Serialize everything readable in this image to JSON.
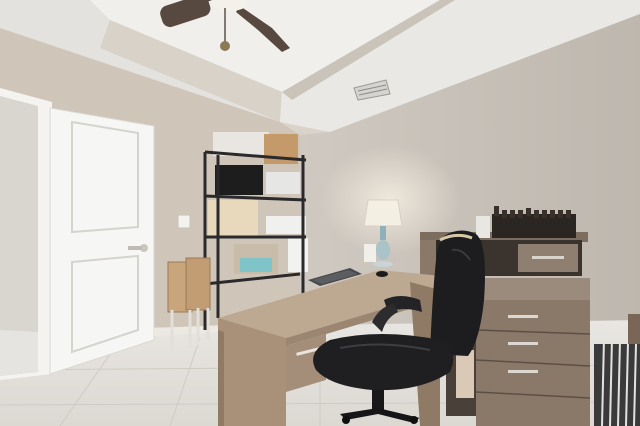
{
  "scene": {
    "kind": "photograph",
    "room": "home-office",
    "palette": {
      "wall_left": "#cfc6b9",
      "wall_right": "#d3cdc5",
      "ceiling": "#ecebe8",
      "floor": "#e4e1dc",
      "door": "#f6f6f4",
      "desk_wood": "#b59f87",
      "cabinet_wood": "#8a7868",
      "chair": "#1d1d1f",
      "shelf_metal": "#2a2a2c"
    },
    "objects": [
      "ceiling-fan",
      "air-vent",
      "open-door",
      "wire-shelving-unit",
      "folding-stools",
      "corner-desk",
      "laptop",
      "mouse",
      "office-chair",
      "table-lamp",
      "sideboard-cabinet",
      "bottles",
      "magazine-rack"
    ]
  }
}
